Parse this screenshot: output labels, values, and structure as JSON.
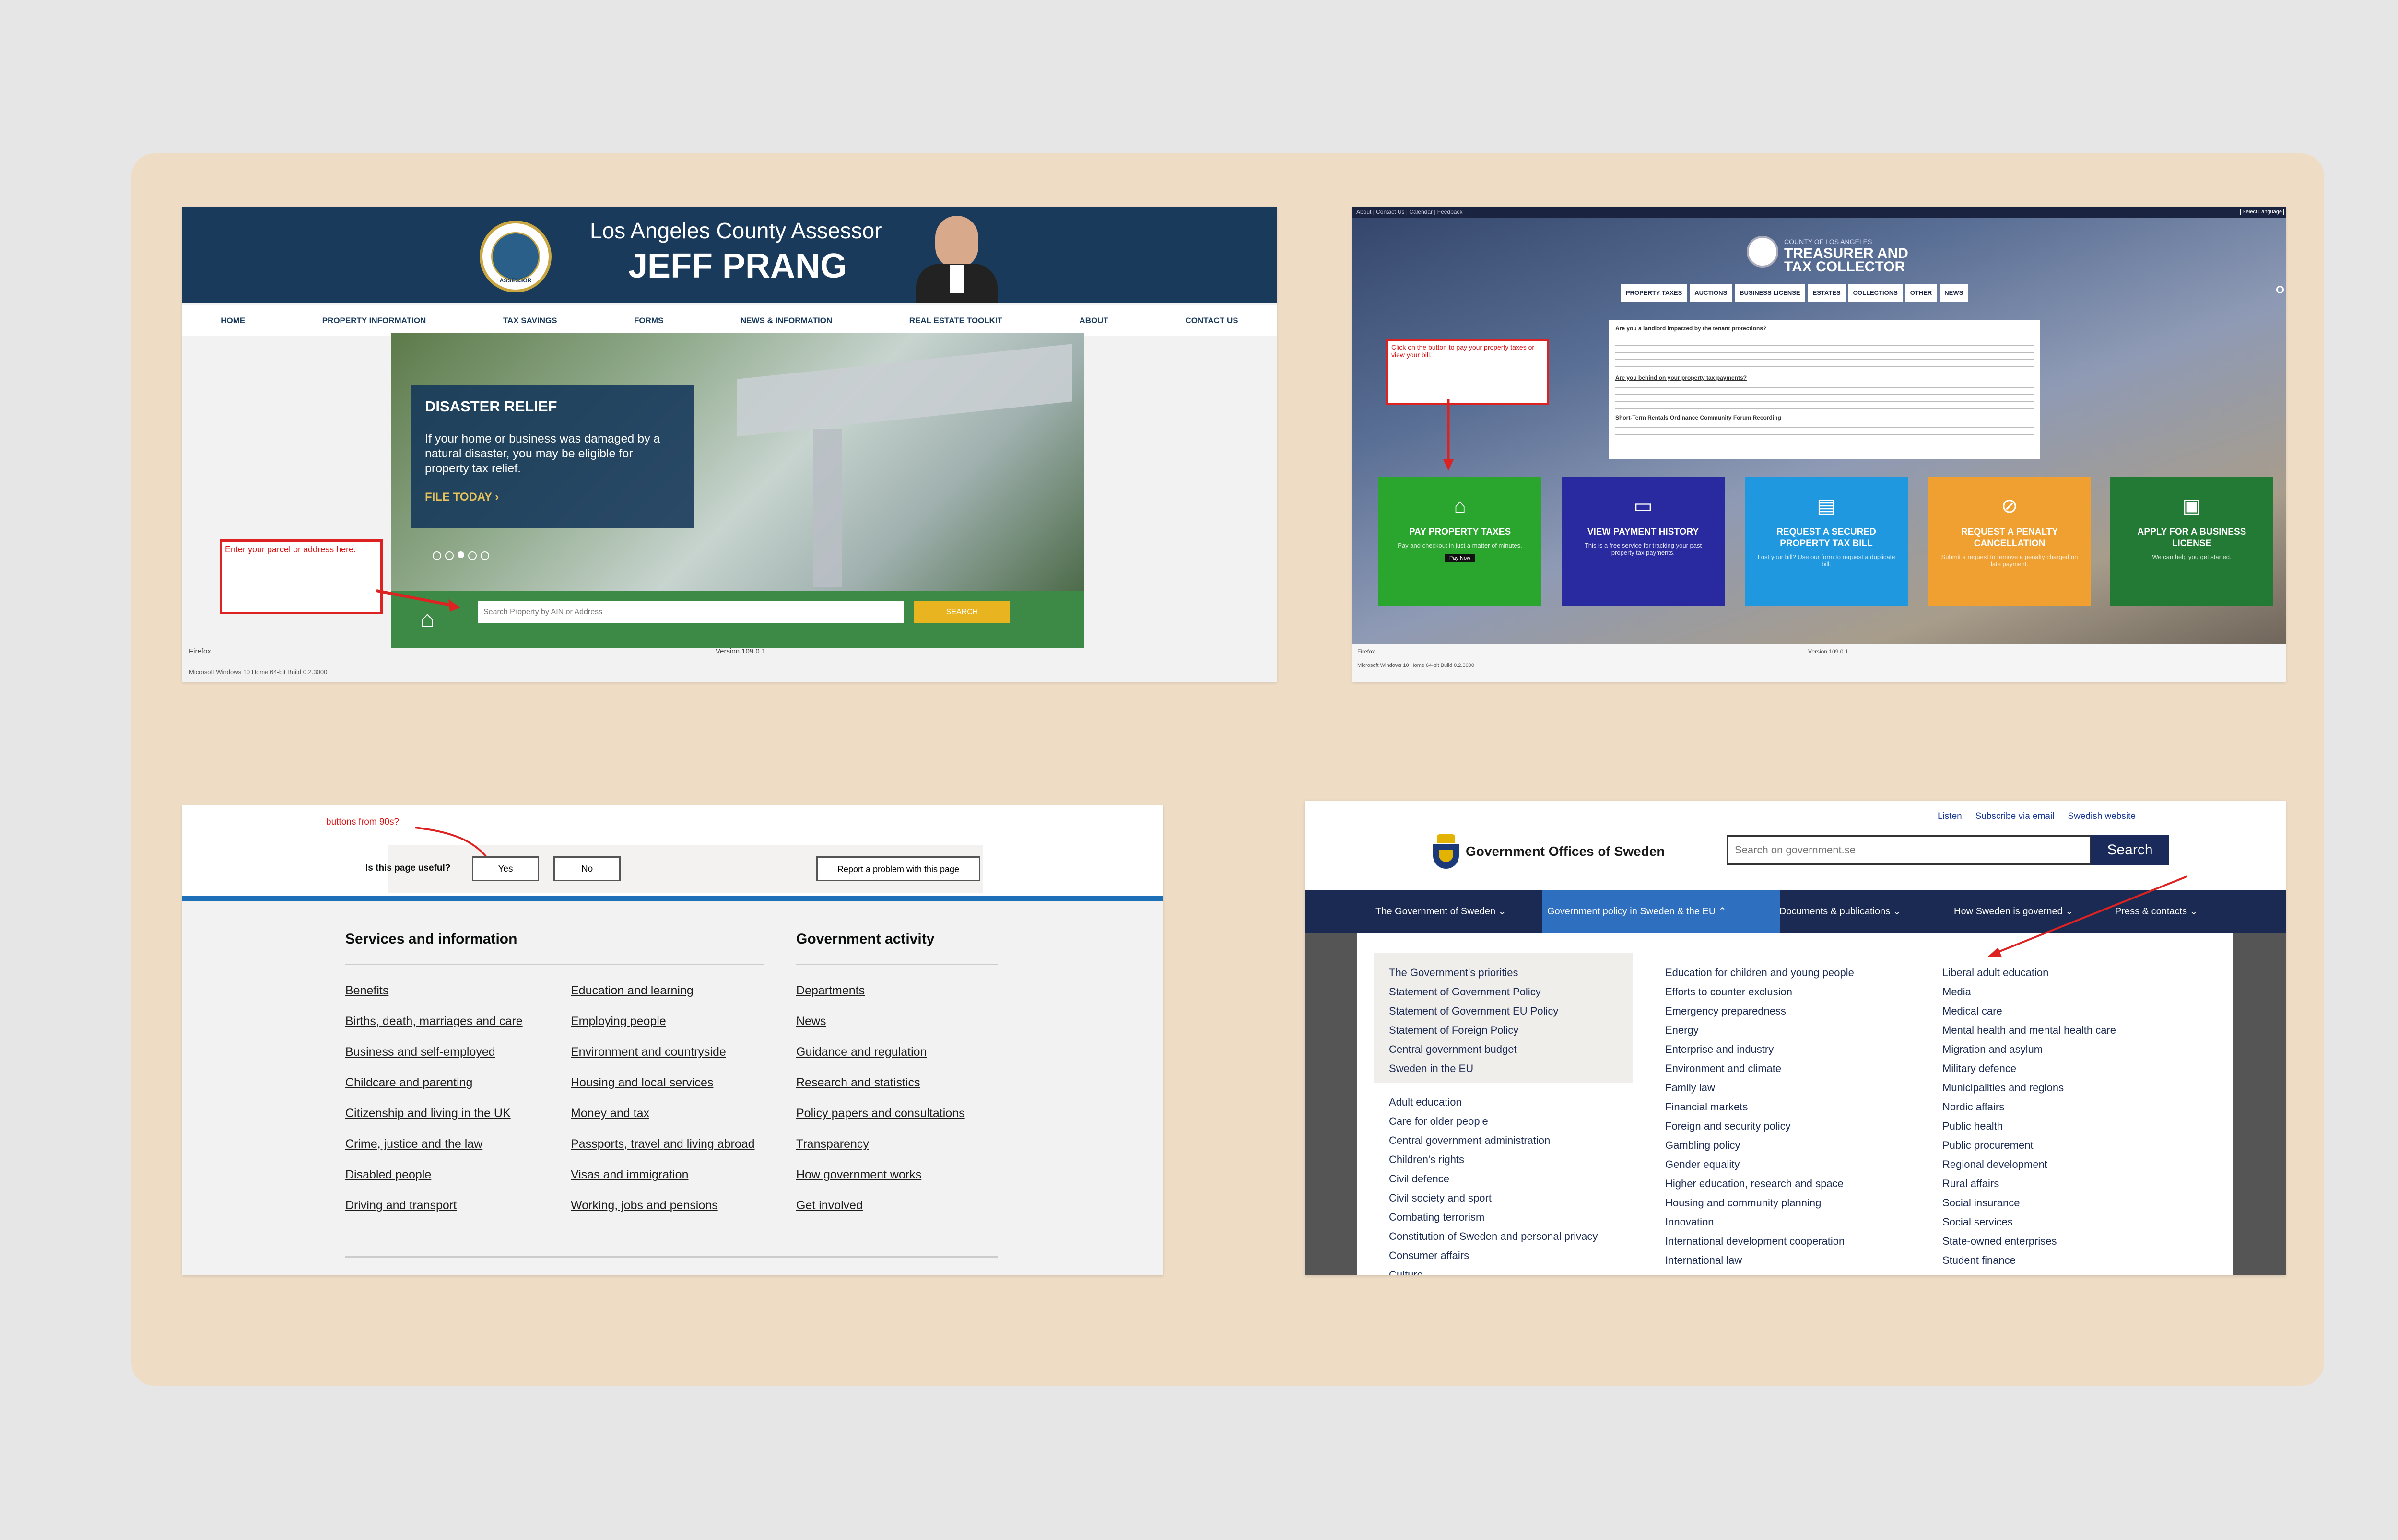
{
  "la_assessor": {
    "title": "Los Angeles County Assessor",
    "name": "JEFF PRANG",
    "seal": "ASSESSOR",
    "nav": [
      "HOME",
      "PROPERTY INFORMATION",
      "TAX SAVINGS",
      "FORMS",
      "NEWS & INFORMATION",
      "REAL ESTATE TOOLKIT",
      "ABOUT",
      "CONTACT US"
    ],
    "banner_title": "DISASTER RELIEF",
    "banner_text": "If your home or business was damaged by a natural disaster, you may be eligible for property tax relief.",
    "banner_link": "FILE TODAY ›",
    "search_placeholder": "Search Property by AIN or Address",
    "search_button": "SEARCH",
    "annotation": "Enter your parcel or address here.",
    "browser": "Firefox",
    "version": "Version 109.0.1",
    "os": "Microsoft Windows 10 Home 64-bit Build 0.2.3000"
  },
  "la_treasurer": {
    "top_links": "About | Contact Us | Calendar | Feedback",
    "lang": "Select Language",
    "county": "COUNTY OF LOS ANGELES",
    "title1": "TREASURER AND",
    "title2": "TAX COLLECTOR",
    "tabs": [
      "PROPERTY TAXES",
      "AUCTIONS",
      "BUSINESS LICENSE",
      "ESTATES",
      "COLLECTIONS",
      "OTHER",
      "NEWS"
    ],
    "annotation": "Click on the button to pay your property taxes or view your bill.",
    "notice_h1": "Are you a landlord impacted by the tenant protections?",
    "notice_h2": "Are you behind on your property tax payments?",
    "notice_h3": "Short-Term Rentals Ordinance Community Forum Recording",
    "tiles": [
      {
        "title": "PAY PROPERTY TAXES",
        "desc": "Pay and checkout in just a matter of minutes.",
        "btn": "Pay Now",
        "color": "#2aa52d",
        "icon": "home-icon",
        "glyph": "⌂"
      },
      {
        "title": "VIEW PAYMENT HISTORY",
        "desc": "This is a free service for tracking your past property tax payments.",
        "btn": "",
        "color": "#2a2aa0",
        "icon": "laptop-icon",
        "glyph": "▭"
      },
      {
        "title": "REQUEST A SECURED PROPERTY TAX BILL",
        "desc": "Lost your bill? Use our form to request a duplicate bill.",
        "btn": "",
        "color": "#1f98e0",
        "icon": "document-icon",
        "glyph": "▤"
      },
      {
        "title": "REQUEST A PENALTY CANCELLATION",
        "desc": "Submit a request to remove a penalty charged on late payment.",
        "btn": "",
        "color": "#f0a030",
        "icon": "prohibited-icon",
        "glyph": "⊘"
      },
      {
        "title": "APPLY FOR A BUSINESS LICENSE",
        "desc": "We can help you get started.",
        "btn": "",
        "color": "#237a35",
        "icon": "id-card-icon",
        "glyph": "▣"
      }
    ],
    "browser": "Firefox",
    "version": "Version 109.0.1",
    "os": "Microsoft Windows 10 Home 64-bit Build 0.2.3000"
  },
  "govuk": {
    "annotation": "buttons from 90s?",
    "question": "Is this page useful?",
    "yes": "Yes",
    "no": "No",
    "report": "Report a problem with this page",
    "services_heading": "Services and information",
    "activity_heading": "Government activity",
    "services_col1": [
      "Benefits",
      "Births, death, marriages and care",
      "Business and self-employed",
      "Childcare and parenting",
      "Citizenship and living in the UK",
      "Crime, justice and the law",
      "Disabled people",
      "Driving and transport"
    ],
    "services_col2": [
      "Education and learning",
      "Employing people",
      "Environment and countryside",
      "Housing and local services",
      "Money and tax",
      "Passports, travel and living abroad",
      "Visas and immigration",
      "Working, jobs and pensions"
    ],
    "activity_col": [
      "Departments",
      "News",
      "Guidance and regulation",
      "Research and statistics",
      "Policy papers and consultations",
      "Transparency",
      "How government works",
      "Get involved"
    ]
  },
  "sweden": {
    "top_links": [
      "Listen",
      "Subscribe via email",
      "Swedish website"
    ],
    "logo_text": "Government Offices of Sweden",
    "search_placeholder": "Search on government.se",
    "search_button": "Search",
    "nav": [
      "The Government of Sweden ⌄",
      "Government policy in Sweden & the EU ⌃",
      "Documents & publications ⌄",
      "How Sweden is governed ⌄",
      "Press & contacts ⌄"
    ],
    "highlight": [
      "The Government's priorities",
      "Statement of Government Policy",
      "Statement of Government EU Policy",
      "Statement of Foreign Policy",
      "Central government budget",
      "Sweden in the EU"
    ],
    "col1": [
      "Adult education",
      "Care for older people",
      "Central government administration",
      "Children's rights",
      "Civil defence",
      "Civil society and sport",
      "Combating terrorism",
      "Constitution of Sweden and personal privacy",
      "Consumer affairs",
      "Culture"
    ],
    "col2": [
      "Education for children and young people",
      "Efforts to counter exclusion",
      "Emergency preparedness",
      "Energy",
      "Enterprise and industry",
      "Environment and climate",
      "Family law",
      "Financial markets",
      "Foreign and security policy",
      "Gambling policy",
      "Gender equality",
      "Higher education, research and space",
      "Housing and community planning",
      "Innovation",
      "International development cooperation",
      "International law"
    ],
    "col3": [
      "Liberal adult education",
      "Media",
      "Medical care",
      "Mental health and mental health care",
      "Migration and asylum",
      "Military defence",
      "Municipalities and regions",
      "Nordic affairs",
      "Public health",
      "Public procurement",
      "Regional development",
      "Rural affairs",
      "Social insurance",
      "Social services",
      "State-owned enterprises",
      "Student finance"
    ]
  }
}
